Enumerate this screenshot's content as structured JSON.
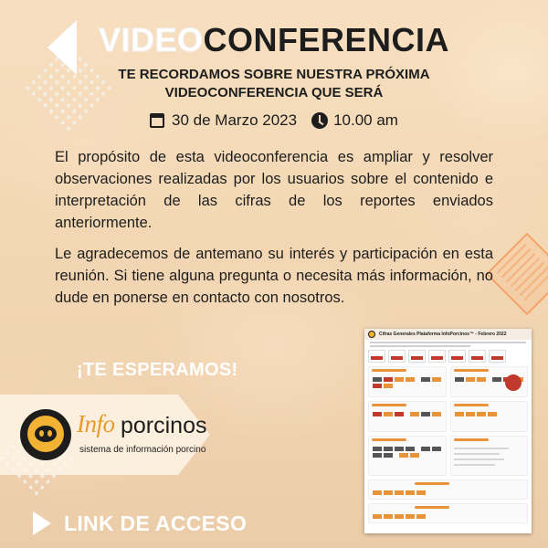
{
  "title": {
    "part1": "VIDEO",
    "part2": "CONFERENCIA"
  },
  "subtitle": {
    "line1": "TE RECORDAMOS SOBRE NUESTRA PRÓXIMA",
    "line2": "VIDEOCONFERENCIA QUE SERÁ"
  },
  "event": {
    "date": "30 de Marzo 2023",
    "time": "10.00 am",
    "date_icon": "calendar-icon",
    "time_icon": "clock-icon"
  },
  "body": {
    "paragraph1": "El propósito de esta videoconferencia es ampliar y resolver observaciones realizadas por los usuarios sobre el contenido e interpretación de las cifras de los reportes enviados anteriormente.",
    "paragraph2": "Le agradecemos de antemano su interés y participación en esta reunión. Si tiene alguna pregunta o necesita más información, no dude en ponerse en contacto con nosotros."
  },
  "cta": {
    "esperamos": "¡TE ESPERAMOS!",
    "link": "LINK DE ACCESO"
  },
  "logo": {
    "info": "Info",
    "porcinos": "porcinos",
    "tagline": "sistema de información porcino"
  },
  "report": {
    "title": "Cifras Generales Plataforma InfoPorcinos™ - Febrero 2022"
  },
  "colors": {
    "accent": "#e8923a",
    "dark": "#1d1d1d",
    "white": "#ffffff",
    "alert": "#c0392b"
  }
}
